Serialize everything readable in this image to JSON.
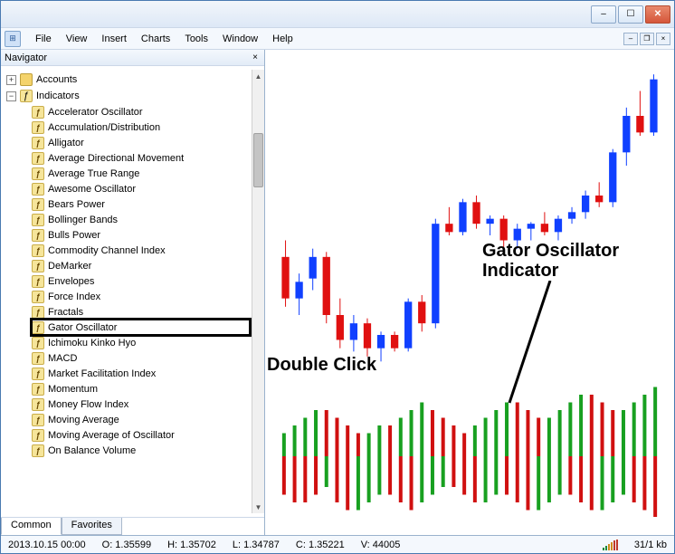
{
  "window": {
    "min_label": "–",
    "max_label": "☐",
    "close_label": "✕"
  },
  "menu": {
    "items": [
      "File",
      "View",
      "Insert",
      "Charts",
      "Tools",
      "Window",
      "Help"
    ]
  },
  "mdi": {
    "min": "–",
    "restore": "❐",
    "close": "×"
  },
  "navigator": {
    "title": "Navigator",
    "close": "×",
    "accounts_label": "Accounts",
    "indicators_label": "Indicators",
    "indicators": [
      "Accelerator Oscillator",
      "Accumulation/Distribution",
      "Alligator",
      "Average Directional Movement",
      "Average True Range",
      "Awesome Oscillator",
      "Bears Power",
      "Bollinger Bands",
      "Bulls Power",
      "Commodity Channel Index",
      "DeMarker",
      "Envelopes",
      "Force Index",
      "Fractals",
      "Gator Oscillator",
      "Ichimoku Kinko Hyo",
      "MACD",
      "Market Facilitation Index",
      "Momentum",
      "Money Flow Index",
      "Moving Average",
      "Moving Average of Oscillator",
      "On Balance Volume"
    ],
    "highlight_index": 14,
    "tabs": {
      "common": "Common",
      "favorites": "Favorites"
    }
  },
  "annotations": {
    "double_click": "Double Click",
    "indicator_name": "Gator Oscillator\nIndicator"
  },
  "status": {
    "datetime": "2013.10.15 00:00",
    "O": "O: 1.35599",
    "H": "H: 1.35702",
    "L": "L: 1.34787",
    "C": "C: 1.35221",
    "V": "V: 44005",
    "kb": "31/1 kb"
  },
  "chart_data": [
    {
      "type": "candlestick",
      "title": "",
      "y_range": [
        1.347,
        1.365
      ],
      "note": "OHLC estimated from pixel heights; colors blue=up red=down",
      "candles": [
        {
          "o": 1.3535,
          "h": 1.3545,
          "l": 1.3505,
          "c": 1.351,
          "color": "red"
        },
        {
          "o": 1.351,
          "h": 1.3525,
          "l": 1.35,
          "c": 1.352,
          "color": "blue"
        },
        {
          "o": 1.3522,
          "h": 1.354,
          "l": 1.3515,
          "c": 1.3535,
          "color": "blue"
        },
        {
          "o": 1.3535,
          "h": 1.3538,
          "l": 1.3495,
          "c": 1.35,
          "color": "red"
        },
        {
          "o": 1.35,
          "h": 1.351,
          "l": 1.348,
          "c": 1.3485,
          "color": "red"
        },
        {
          "o": 1.3485,
          "h": 1.35,
          "l": 1.3478,
          "c": 1.3495,
          "color": "blue"
        },
        {
          "o": 1.3495,
          "h": 1.3498,
          "l": 1.3475,
          "c": 1.348,
          "color": "red"
        },
        {
          "o": 1.348,
          "h": 1.349,
          "l": 1.3472,
          "c": 1.3488,
          "color": "blue"
        },
        {
          "o": 1.3488,
          "h": 1.349,
          "l": 1.3478,
          "c": 1.348,
          "color": "red"
        },
        {
          "o": 1.348,
          "h": 1.351,
          "l": 1.3478,
          "c": 1.3508,
          "color": "blue"
        },
        {
          "o": 1.3508,
          "h": 1.3512,
          "l": 1.349,
          "c": 1.3495,
          "color": "red"
        },
        {
          "o": 1.3495,
          "h": 1.3558,
          "l": 1.3492,
          "c": 1.3555,
          "color": "blue"
        },
        {
          "o": 1.3555,
          "h": 1.3565,
          "l": 1.3548,
          "c": 1.355,
          "color": "red"
        },
        {
          "o": 1.355,
          "h": 1.357,
          "l": 1.3548,
          "c": 1.3568,
          "color": "blue"
        },
        {
          "o": 1.3568,
          "h": 1.3572,
          "l": 1.3552,
          "c": 1.3555,
          "color": "red"
        },
        {
          "o": 1.3555,
          "h": 1.356,
          "l": 1.3548,
          "c": 1.3558,
          "color": "blue"
        },
        {
          "o": 1.3558,
          "h": 1.356,
          "l": 1.354,
          "c": 1.3545,
          "color": "red"
        },
        {
          "o": 1.3545,
          "h": 1.3555,
          "l": 1.354,
          "c": 1.3552,
          "color": "blue"
        },
        {
          "o": 1.3552,
          "h": 1.3556,
          "l": 1.3545,
          "c": 1.3555,
          "color": "blue"
        },
        {
          "o": 1.3555,
          "h": 1.3562,
          "l": 1.3548,
          "c": 1.355,
          "color": "red"
        },
        {
          "o": 1.355,
          "h": 1.356,
          "l": 1.3545,
          "c": 1.3558,
          "color": "blue"
        },
        {
          "o": 1.3558,
          "h": 1.3565,
          "l": 1.3555,
          "c": 1.3562,
          "color": "blue"
        },
        {
          "o": 1.3562,
          "h": 1.3575,
          "l": 1.3558,
          "c": 1.3572,
          "color": "blue"
        },
        {
          "o": 1.3572,
          "h": 1.358,
          "l": 1.3565,
          "c": 1.3568,
          "color": "red"
        },
        {
          "o": 1.3568,
          "h": 1.36,
          "l": 1.3565,
          "c": 1.3598,
          "color": "blue"
        },
        {
          "o": 1.3598,
          "h": 1.3625,
          "l": 1.359,
          "c": 1.362,
          "color": "blue"
        },
        {
          "o": 1.362,
          "h": 1.3635,
          "l": 1.3608,
          "c": 1.361,
          "color": "red"
        },
        {
          "o": 1.361,
          "h": 1.3645,
          "l": 1.3608,
          "c": 1.3642,
          "color": "blue"
        }
      ]
    },
    {
      "type": "gator-oscillator",
      "note": "Two histogram rows around zero line; values estimated",
      "y_range_top": [
        0,
        10
      ],
      "y_range_bottom": [
        -10,
        0
      ],
      "bars": [
        {
          "top": 3,
          "tc": "g",
          "bot": -5,
          "bc": "r"
        },
        {
          "top": 4,
          "tc": "g",
          "bot": -6,
          "bc": "r"
        },
        {
          "top": 5,
          "tc": "g",
          "bot": -6,
          "bc": "r"
        },
        {
          "top": 6,
          "tc": "g",
          "bot": -5,
          "bc": "r"
        },
        {
          "top": 6,
          "tc": "r",
          "bot": -4,
          "bc": "g"
        },
        {
          "top": 5,
          "tc": "r",
          "bot": -6,
          "bc": "r"
        },
        {
          "top": 4,
          "tc": "r",
          "bot": -7,
          "bc": "r"
        },
        {
          "top": 3,
          "tc": "r",
          "bot": -7,
          "bc": "g"
        },
        {
          "top": 3,
          "tc": "g",
          "bot": -6,
          "bc": "g"
        },
        {
          "top": 4,
          "tc": "g",
          "bot": -5,
          "bc": "g"
        },
        {
          "top": 4,
          "tc": "r",
          "bot": -5,
          "bc": "r"
        },
        {
          "top": 5,
          "tc": "g",
          "bot": -6,
          "bc": "r"
        },
        {
          "top": 6,
          "tc": "g",
          "bot": -7,
          "bc": "r"
        },
        {
          "top": 7,
          "tc": "g",
          "bot": -6,
          "bc": "g"
        },
        {
          "top": 6,
          "tc": "r",
          "bot": -5,
          "bc": "g"
        },
        {
          "top": 5,
          "tc": "r",
          "bot": -4,
          "bc": "g"
        },
        {
          "top": 4,
          "tc": "r",
          "bot": -4,
          "bc": "r"
        },
        {
          "top": 3,
          "tc": "r",
          "bot": -5,
          "bc": "r"
        },
        {
          "top": 4,
          "tc": "g",
          "bot": -6,
          "bc": "r"
        },
        {
          "top": 5,
          "tc": "g",
          "bot": -6,
          "bc": "g"
        },
        {
          "top": 6,
          "tc": "g",
          "bot": -5,
          "bc": "g"
        },
        {
          "top": 7,
          "tc": "g",
          "bot": -5,
          "bc": "r"
        },
        {
          "top": 7,
          "tc": "r",
          "bot": -6,
          "bc": "r"
        },
        {
          "top": 6,
          "tc": "r",
          "bot": -7,
          "bc": "r"
        },
        {
          "top": 5,
          "tc": "r",
          "bot": -7,
          "bc": "g"
        },
        {
          "top": 5,
          "tc": "g",
          "bot": -6,
          "bc": "g"
        },
        {
          "top": 6,
          "tc": "g",
          "bot": -5,
          "bc": "g"
        },
        {
          "top": 7,
          "tc": "g",
          "bot": -5,
          "bc": "r"
        },
        {
          "top": 8,
          "tc": "g",
          "bot": -6,
          "bc": "r"
        },
        {
          "top": 8,
          "tc": "r",
          "bot": -7,
          "bc": "r"
        },
        {
          "top": 7,
          "tc": "r",
          "bot": -7,
          "bc": "g"
        },
        {
          "top": 6,
          "tc": "r",
          "bot": -6,
          "bc": "g"
        },
        {
          "top": 6,
          "tc": "g",
          "bot": -5,
          "bc": "g"
        },
        {
          "top": 7,
          "tc": "g",
          "bot": -6,
          "bc": "r"
        },
        {
          "top": 8,
          "tc": "g",
          "bot": -7,
          "bc": "r"
        },
        {
          "top": 9,
          "tc": "g",
          "bot": -8,
          "bc": "r"
        }
      ]
    }
  ]
}
